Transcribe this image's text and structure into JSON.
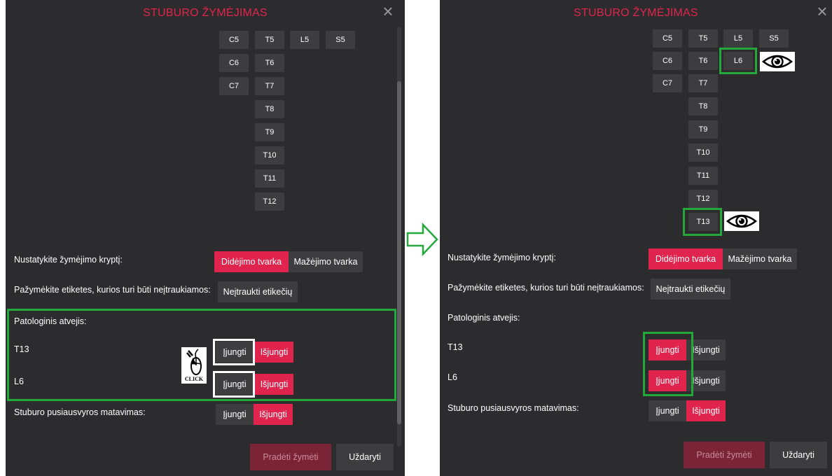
{
  "dialog": {
    "title": "STUBURO ŽYMĖJIMAS",
    "close_symbol": "×"
  },
  "vertebrae": {
    "c5": "C5",
    "c6": "C6",
    "c7": "C7",
    "t5": "T5",
    "t6": "T6",
    "t7": "T7",
    "t8": "T8",
    "t9": "T9",
    "t10": "T10",
    "t11": "T11",
    "t12": "T12",
    "t13": "T13",
    "l5": "L5",
    "l6": "L6",
    "s5": "S5"
  },
  "direction": {
    "label": "Nustatykite žymėjimo kryptį:",
    "ascending": "Didėjimo tvarka",
    "descending": "Mažėjimo tvarka"
  },
  "exclude": {
    "label": "Pažymėkite etiketes, kurios turi būti neįtraukiamos:",
    "button": "Neįtraukti etikečių"
  },
  "pathology": {
    "label": "Patologinis atvejis:",
    "rows": [
      {
        "name": "T13",
        "on": "Įjungti",
        "off": "Išjungti"
      },
      {
        "name": "L6",
        "on": "Įjungti",
        "off": "Išjungti"
      }
    ]
  },
  "balance": {
    "label": "Stuburo pusiausvyros matavimas:",
    "on": "Įjungti",
    "off": "Išjungti"
  },
  "footer": {
    "start": "Pradėti žymėti",
    "close": "Uždaryti"
  },
  "annotation": {
    "click_text": "CLICK"
  },
  "colors": {
    "accent": "#e0244e",
    "highlight_green": "#24a83c",
    "panel_bg": "#2c2c2e",
    "button_bg": "#3d3d40"
  }
}
